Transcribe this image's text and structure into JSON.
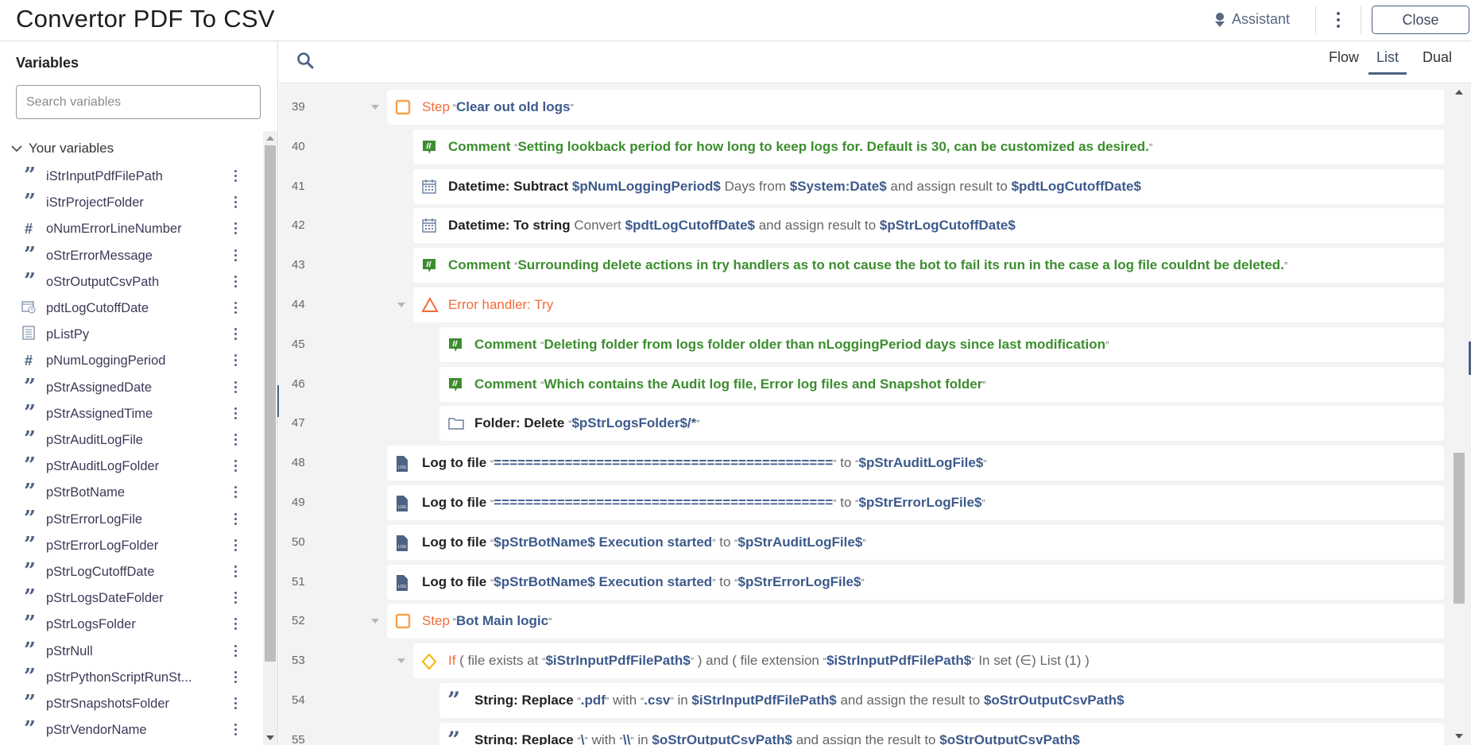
{
  "header": {
    "title": "Convertor PDF To CSV",
    "assistant_label": "Assistant",
    "close_label": "Close"
  },
  "sidebar": {
    "title": "Variables",
    "search_placeholder": "Search variables",
    "section_label": "Your variables",
    "variables": [
      {
        "name": "iStrInputPdfFilePath",
        "type": "string"
      },
      {
        "name": "iStrProjectFolder",
        "type": "string"
      },
      {
        "name": "oNumErrorLineNumber",
        "type": "number"
      },
      {
        "name": "oStrErrorMessage",
        "type": "string"
      },
      {
        "name": "oStrOutputCsvPath",
        "type": "string"
      },
      {
        "name": "pdtLogCutoffDate",
        "type": "datetime"
      },
      {
        "name": "pListPy",
        "type": "list"
      },
      {
        "name": "pNumLoggingPeriod",
        "type": "number"
      },
      {
        "name": "pStrAssignedDate",
        "type": "string"
      },
      {
        "name": "pStrAssignedTime",
        "type": "string"
      },
      {
        "name": "pStrAuditLogFile",
        "type": "string"
      },
      {
        "name": "pStrAuditLogFolder",
        "type": "string"
      },
      {
        "name": "pStrBotName",
        "type": "string"
      },
      {
        "name": "pStrErrorLogFile",
        "type": "string"
      },
      {
        "name": "pStrErrorLogFolder",
        "type": "string"
      },
      {
        "name": "pStrLogCutoffDate",
        "type": "string"
      },
      {
        "name": "pStrLogsDateFolder",
        "type": "string"
      },
      {
        "name": "pStrLogsFolder",
        "type": "string"
      },
      {
        "name": "pStrNull",
        "type": "string"
      },
      {
        "name": "pStrPythonScriptRunSt...",
        "type": "string"
      },
      {
        "name": "pStrSnapshotsFolder",
        "type": "string"
      },
      {
        "name": "pStrVendorName",
        "type": "string"
      }
    ]
  },
  "toolbar": {
    "tabs": [
      {
        "label": "Flow",
        "active": false
      },
      {
        "label": "List",
        "active": true
      },
      {
        "label": "Dual",
        "active": false
      }
    ]
  },
  "colors": {
    "accent": "#4d6184",
    "step": "#f26b3a",
    "step_icon": "#f5a347",
    "comment": "#3c8d2f",
    "variable": "#3d5a8c"
  },
  "rows": [
    {
      "line": "39",
      "level": 0,
      "chevron": true,
      "icon": "step",
      "segments": [
        [
          "step",
          "Step"
        ],
        [
          "q",
          " “"
        ],
        [
          "var",
          "Clear out old logs"
        ],
        [
          "q",
          "”"
        ]
      ]
    },
    {
      "line": "40",
      "level": 1,
      "icon": "comment",
      "segments": [
        [
          "green",
          "Comment "
        ],
        [
          "gq",
          "“"
        ],
        [
          "green",
          "Setting lookback period for how long to keep logs for. Default is 30, can be customized as desired."
        ],
        [
          "gq",
          "”"
        ]
      ]
    },
    {
      "line": "41",
      "level": 1,
      "icon": "calendar",
      "segments": [
        [
          "key",
          "Datetime: Subtract "
        ],
        [
          "var",
          "$pNumLoggingPeriod$"
        ],
        [
          "plain",
          " Days from "
        ],
        [
          "var",
          "$System:Date$"
        ],
        [
          "plain",
          " and assign result to "
        ],
        [
          "var",
          "$pdtLogCutoffDate$"
        ]
      ]
    },
    {
      "line": "42",
      "level": 1,
      "icon": "calendar",
      "segments": [
        [
          "key",
          "Datetime: To string"
        ],
        [
          "plain",
          " Convert "
        ],
        [
          "var",
          "$pdtLogCutoffDate$"
        ],
        [
          "plain",
          " and assign result to "
        ],
        [
          "var",
          "$pStrLogCutoffDate$"
        ]
      ]
    },
    {
      "line": "43",
      "level": 1,
      "icon": "comment",
      "segments": [
        [
          "green",
          "Comment "
        ],
        [
          "gq",
          "“"
        ],
        [
          "green",
          "Surrounding delete actions in try handlers as to not cause the bot to fail its run in the case a log file couldnt be deleted."
        ],
        [
          "gq",
          "”"
        ]
      ]
    },
    {
      "line": "44",
      "level": 1,
      "chevron": true,
      "icon": "error",
      "segments": [
        [
          "err",
          "Error handler: Try"
        ]
      ]
    },
    {
      "line": "45",
      "level": 2,
      "icon": "comment",
      "segments": [
        [
          "green",
          "Comment "
        ],
        [
          "gq",
          "“"
        ],
        [
          "green",
          "Deleting folder from logs folder older than nLoggingPeriod days since last modification"
        ],
        [
          "gq",
          "”"
        ]
      ]
    },
    {
      "line": "46",
      "level": 2,
      "icon": "comment",
      "segments": [
        [
          "green",
          "Comment "
        ],
        [
          "gq",
          "“"
        ],
        [
          "green",
          "Which contains the Audit log file, Error log files and Snapshot folder"
        ],
        [
          "gq",
          "”"
        ]
      ]
    },
    {
      "line": "47",
      "level": 2,
      "icon": "folder",
      "segments": [
        [
          "key",
          "Folder: Delete "
        ],
        [
          "q",
          "“"
        ],
        [
          "var",
          "$pStrLogsFolder$/*"
        ],
        [
          "q",
          "”"
        ]
      ]
    },
    {
      "line": "48",
      "level": 0,
      "icon": "log",
      "segments": [
        [
          "key",
          "Log to file "
        ],
        [
          "q",
          "“"
        ],
        [
          "var",
          "==========================================="
        ],
        [
          "q",
          "”"
        ],
        [
          "plain",
          " to "
        ],
        [
          "q",
          "“"
        ],
        [
          "var",
          "$pStrAuditLogFile$"
        ],
        [
          "q",
          "”"
        ]
      ]
    },
    {
      "line": "49",
      "level": 0,
      "icon": "log",
      "segments": [
        [
          "key",
          "Log to file "
        ],
        [
          "q",
          "“"
        ],
        [
          "var",
          "==========================================="
        ],
        [
          "q",
          "”"
        ],
        [
          "plain",
          " to "
        ],
        [
          "q",
          "“"
        ],
        [
          "var",
          "$pStrErrorLogFile$"
        ],
        [
          "q",
          "”"
        ]
      ]
    },
    {
      "line": "50",
      "level": 0,
      "icon": "log",
      "segments": [
        [
          "key",
          "Log to file "
        ],
        [
          "q",
          "“"
        ],
        [
          "var",
          "$pStrBotName$ Execution started"
        ],
        [
          "q",
          "”"
        ],
        [
          "plain",
          " to "
        ],
        [
          "q",
          "“"
        ],
        [
          "var",
          "$pStrAuditLogFile$"
        ],
        [
          "q",
          "”"
        ]
      ]
    },
    {
      "line": "51",
      "level": 0,
      "icon": "log",
      "segments": [
        [
          "key",
          "Log to file "
        ],
        [
          "q",
          "“"
        ],
        [
          "var",
          "$pStrBotName$ Execution started"
        ],
        [
          "q",
          "”"
        ],
        [
          "plain",
          " to "
        ],
        [
          "q",
          "“"
        ],
        [
          "var",
          "$pStrErrorLogFile$"
        ],
        [
          "q",
          "”"
        ]
      ]
    },
    {
      "line": "52",
      "level": 0,
      "chevron": true,
      "icon": "step",
      "segments": [
        [
          "step",
          "Step"
        ],
        [
          "q",
          " “"
        ],
        [
          "var",
          "Bot Main logic"
        ],
        [
          "q",
          "”"
        ]
      ]
    },
    {
      "line": "53",
      "level": 1,
      "chevron": true,
      "icon": "if",
      "segments": [
        [
          "if",
          "If"
        ],
        [
          "plain",
          " ( file exists at "
        ],
        [
          "q",
          "“"
        ],
        [
          "var",
          "$iStrInputPdfFilePath$"
        ],
        [
          "q",
          "”"
        ],
        [
          "plain",
          " ) and ( file extension "
        ],
        [
          "q",
          "“"
        ],
        [
          "var",
          "$iStrInputPdfFilePath$"
        ],
        [
          "q",
          "”"
        ],
        [
          "plain",
          " In set (∈) List (1) )"
        ]
      ]
    },
    {
      "line": "54",
      "level": 2,
      "icon": "string",
      "segments": [
        [
          "key",
          "String: Replace "
        ],
        [
          "q",
          "“"
        ],
        [
          "var",
          ".pdf"
        ],
        [
          "q",
          "”"
        ],
        [
          "plain",
          " with "
        ],
        [
          "q",
          "“"
        ],
        [
          "var",
          ".csv"
        ],
        [
          "q",
          "”"
        ],
        [
          "plain",
          " in "
        ],
        [
          "var",
          "$iStrInputPdfFilePath$"
        ],
        [
          "plain",
          " and assign the result to "
        ],
        [
          "var",
          "$oStrOutputCsvPath$"
        ]
      ]
    },
    {
      "line": "55",
      "level": 2,
      "icon": "string",
      "segments": [
        [
          "key",
          "String: Replace "
        ],
        [
          "q",
          "“"
        ],
        [
          "var",
          "\\"
        ],
        [
          "q",
          "”"
        ],
        [
          "plain",
          " with "
        ],
        [
          "q",
          "“"
        ],
        [
          "var",
          "\\\\"
        ],
        [
          "q",
          "”"
        ],
        [
          "plain",
          " in "
        ],
        [
          "var",
          "$oStrOutputCsvPath$"
        ],
        [
          "plain",
          " and assign the result to "
        ],
        [
          "var",
          "$oStrOutputCsvPath$"
        ]
      ]
    }
  ]
}
